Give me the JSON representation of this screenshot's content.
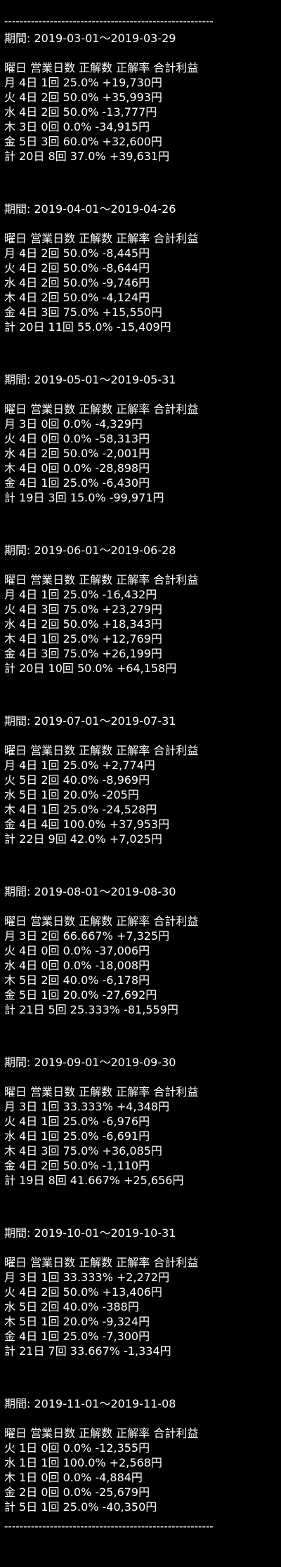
{
  "rule": "-------------------------------------------------------",
  "header_labels": "曜日 営業日数 正解数 正解率 合計利益",
  "periods": [
    {
      "label": "期間: 2019-03-01～2019-03-29",
      "rows": [
        "月 4日 1回 25.0% +19,730円",
        "火 4日 2回 50.0% +35,993円",
        "水 4日 2回 50.0% -13,777円",
        "木 3日 0回 0.0% -34,915円",
        "金 5日 3回 60.0% +32,600円",
        "計 20日 8回 37.0% +39,631円"
      ]
    },
    {
      "label": "期間: 2019-04-01～2019-04-26",
      "rows": [
        "月 4日 2回 50.0% -8,445円",
        "火 4日 2回 50.0% -8,644円",
        "水 4日 2回 50.0% -9,746円",
        "木 4日 2回 50.0% -4,124円",
        "金 4日 3回 75.0% +15,550円",
        "計 20日 11回 55.0% -15,409円"
      ]
    },
    {
      "label": "期間: 2019-05-01～2019-05-31",
      "rows": [
        "月 3日 0回 0.0% -4,329円",
        "火 4日 0回 0.0% -58,313円",
        "水 4日 2回 50.0% -2,001円",
        "木 4日 0回 0.0% -28,898円",
        "金 4日 1回 25.0% -6,430円",
        "計 19日 3回 15.0% -99,971円"
      ]
    },
    {
      "label": "期間: 2019-06-01～2019-06-28",
      "rows": [
        "月 4日 1回 25.0% -16,432円",
        "火 4日 3回 75.0% +23,279円",
        "水 4日 2回 50.0% +18,343円",
        "木 4日 1回 25.0% +12,769円",
        "金 4日 3回 75.0% +26,199円",
        "計 20日 10回 50.0% +64,158円"
      ]
    },
    {
      "label": "期間: 2019-07-01～2019-07-31",
      "rows": [
        "月 4日 1回 25.0% +2,774円",
        "火 5日 2回 40.0% -8,969円",
        "水 5日 1回 20.0% -205円",
        "木 4日 1回 25.0% -24,528円",
        "金 4日 4回 100.0% +37,953円",
        "計 22日 9回 42.0% +7,025円"
      ]
    },
    {
      "label": "期間: 2019-08-01～2019-08-30",
      "rows": [
        "月 3日 2回 66.667% +7,325円",
        "火 4日 0回 0.0% -37,006円",
        "水 4日 0回 0.0% -18,008円",
        "木 5日 2回 40.0% -6,178円",
        "金 5日 1回 20.0% -27,692円",
        "計 21日 5回 25.333% -81,559円"
      ]
    },
    {
      "label": "期間: 2019-09-01～2019-09-30",
      "rows": [
        "月 3日 1回 33.333% +4,348円",
        "火 4日 1回 25.0% -6,976円",
        "水 4日 1回 25.0% -6,691円",
        "木 4日 3回 75.0% +36,085円",
        "金 4日 2回 50.0% -1,110円",
        "計 19日 8回 41.667% +25,656円"
      ]
    },
    {
      "label": "期間: 2019-10-01～2019-10-31",
      "rows": [
        "月 3日 1回 33.333% +2,272円",
        "火 4日 2回 50.0% +13,406円",
        "水 5日 2回 40.0% -388円",
        "木 5日 1回 20.0% -9,324円",
        "金 4日 1回 25.0% -7,300円",
        "計 21日 7回 33.667% -1,334円"
      ]
    },
    {
      "label": "期間: 2019-11-01～2019-11-08",
      "rows": [
        "火 1日 0回 0.0% -12,355円",
        "水 1日 1回 100.0% +2,568円",
        "木 1日 0回 0.0% -4,884円",
        "金 2日 0回 0.0% -25,679円",
        "計 5日 1回 25.0% -40,350円"
      ]
    }
  ]
}
